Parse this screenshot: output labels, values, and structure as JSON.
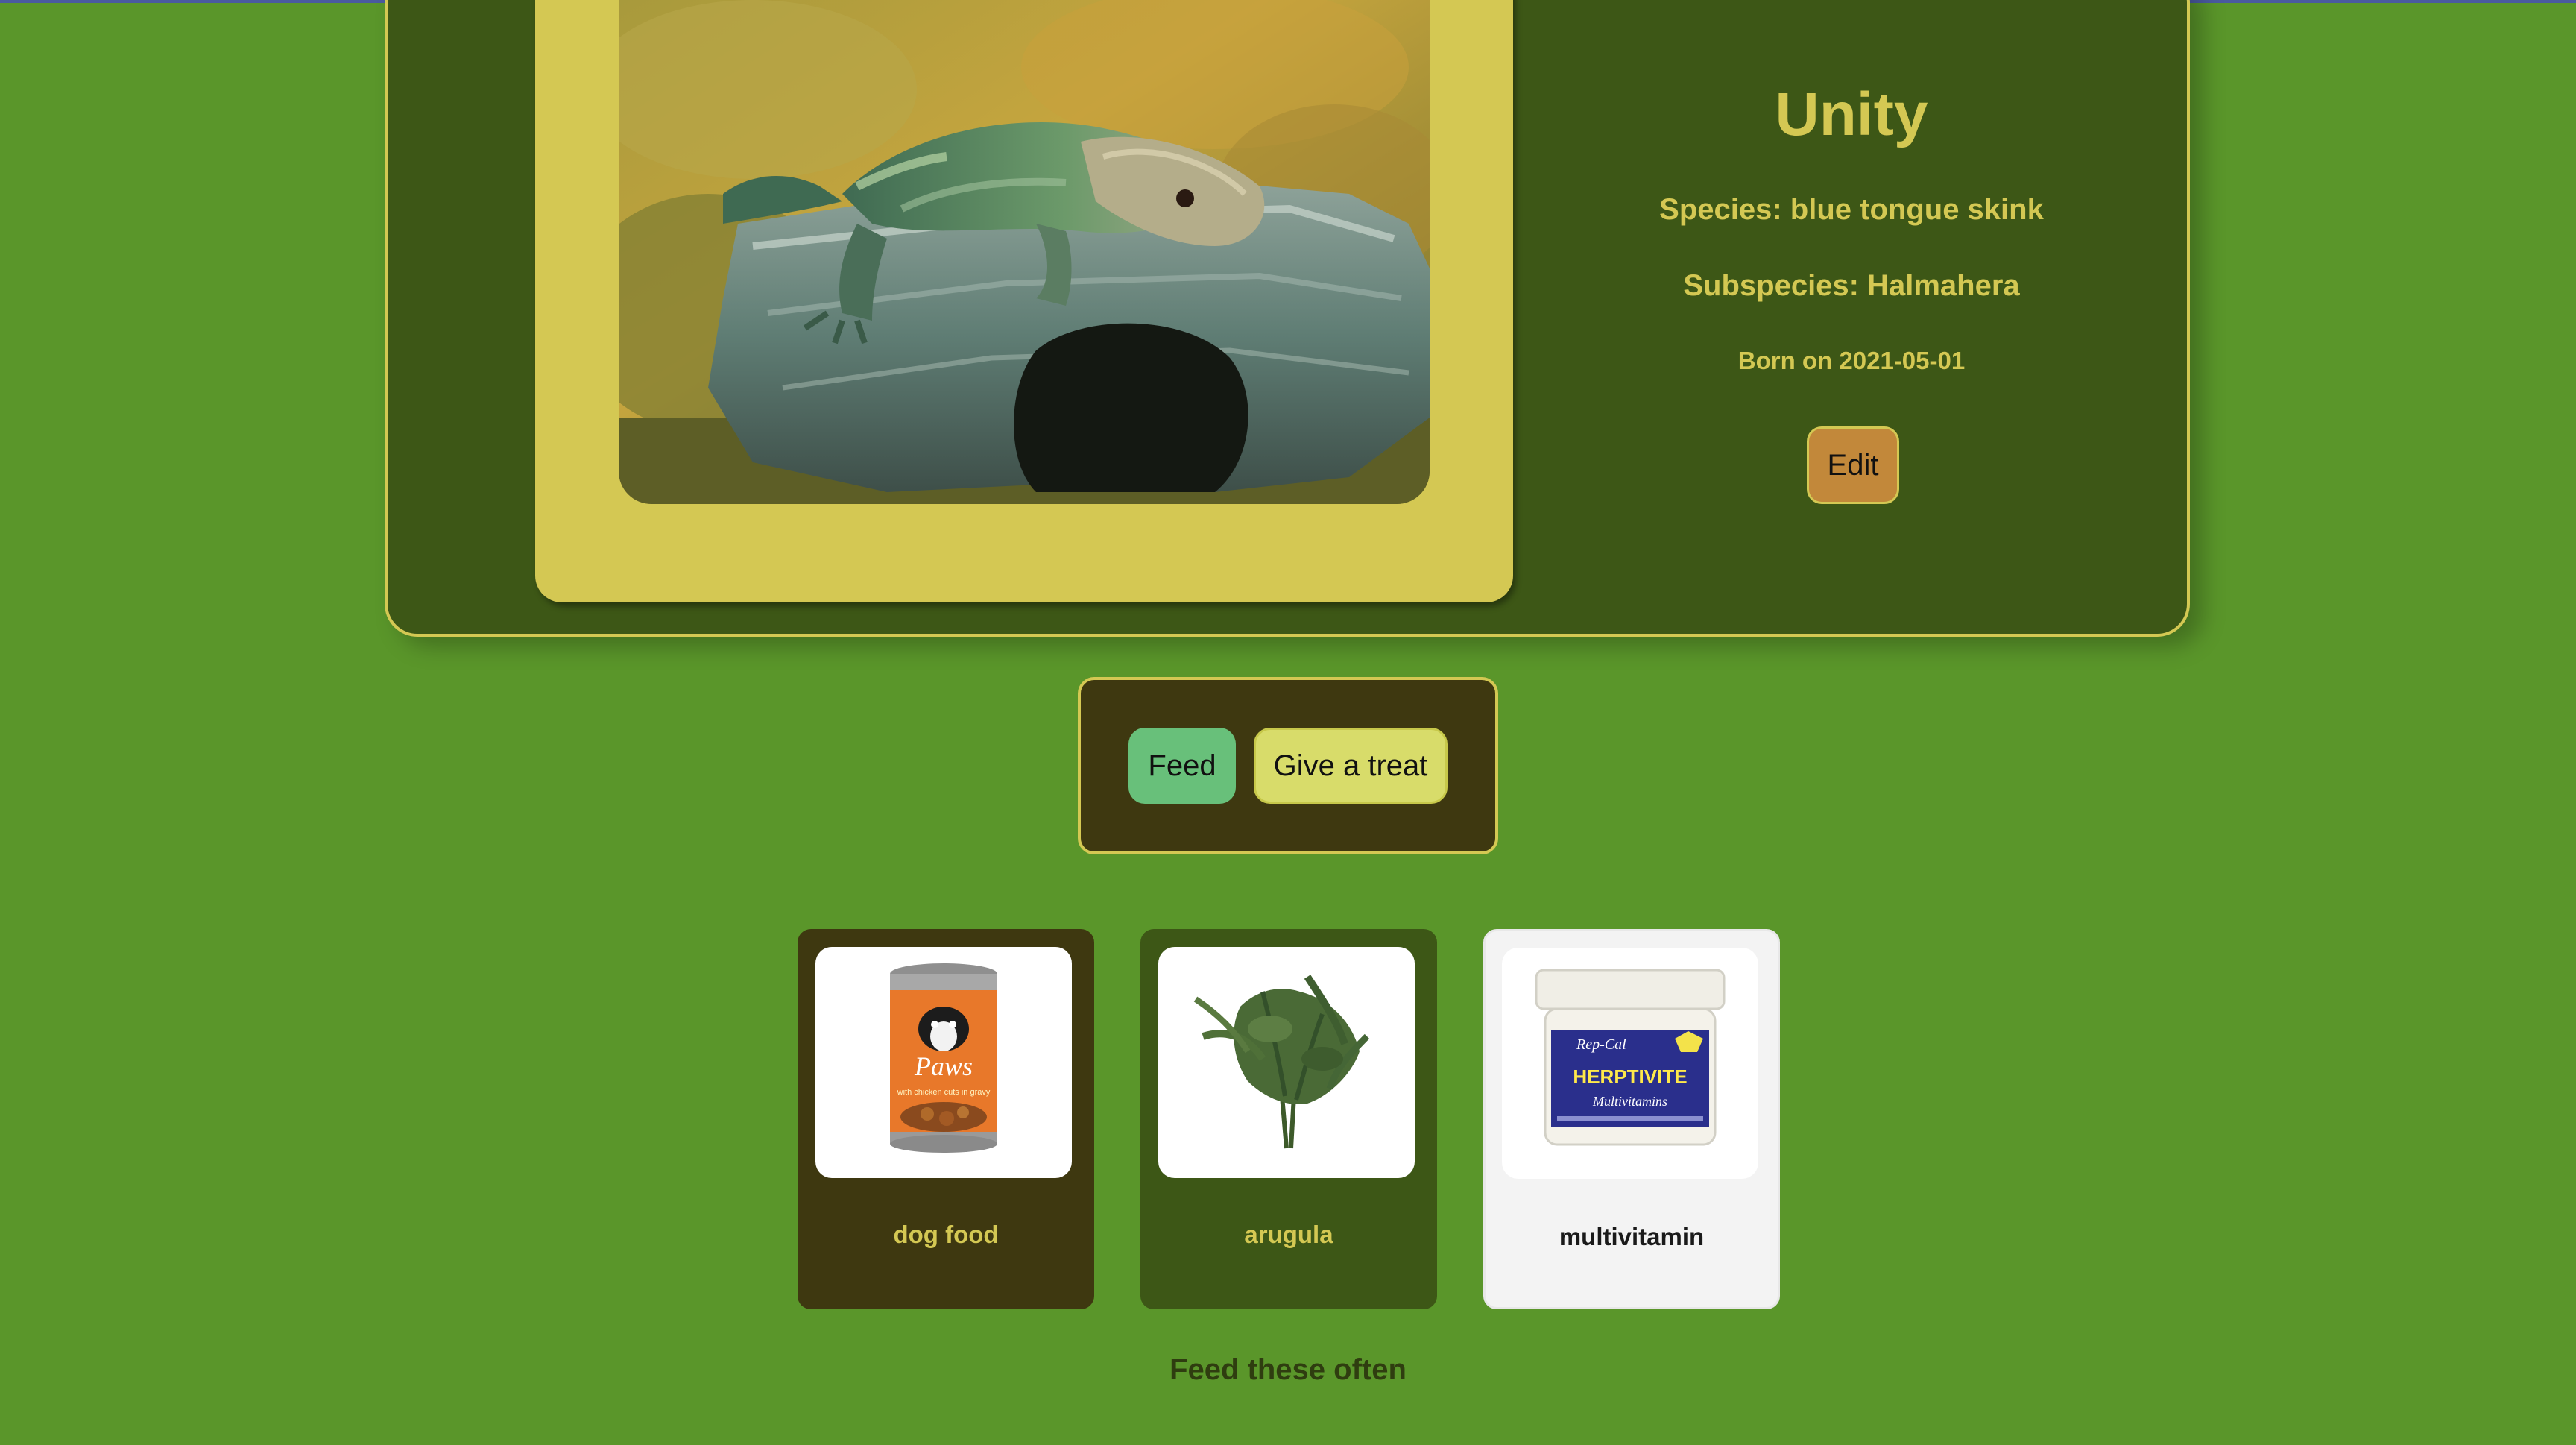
{
  "pet": {
    "name": "Unity",
    "species_line": "Species: blue tongue skink",
    "subspecies_line": "Subspecies: Halmahera",
    "born_line": "Born on 2021-05-01",
    "photo_icon": "skink-photo",
    "edit_label": "Edit"
  },
  "actions": {
    "feed_label": "Feed",
    "treat_label": "Give a treat"
  },
  "foods": [
    {
      "name": "dog food",
      "icon": "dog-food-can"
    },
    {
      "name": "arugula",
      "icon": "arugula-bunch"
    },
    {
      "name": "multivitamin",
      "icon": "multivitamin-jar"
    }
  ],
  "can_label": {
    "brand": "Paws",
    "text": "with chicken cuts in gravy"
  },
  "jar_label": {
    "maker": "Rep-Cal",
    "product": "HERPTIVITE",
    "subtitle": "Multivitamins"
  },
  "footer_note": "Feed these often",
  "colors": {
    "page_bg": "#5a962a",
    "card_dark_green": "#3d5716",
    "card_dark_olive": "#3e3810",
    "accent_yellow": "#d4c853",
    "feed_green": "#68c07a",
    "edit_orange": "#c2883a"
  }
}
